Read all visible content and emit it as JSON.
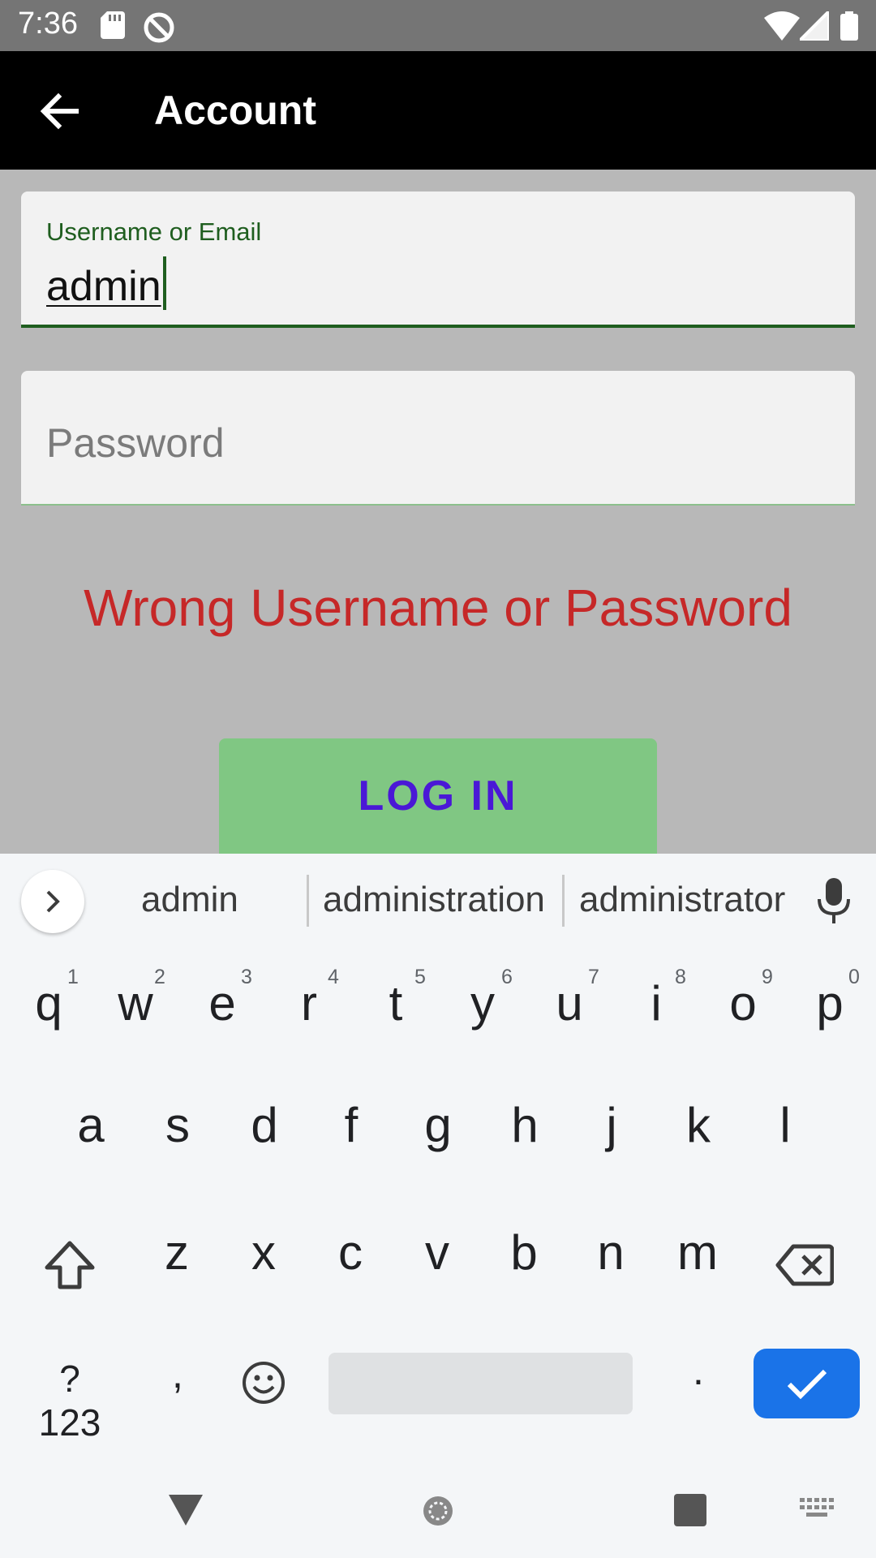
{
  "status_bar": {
    "time": "7:36"
  },
  "app_bar": {
    "title": "Account"
  },
  "form": {
    "username_label": "Username or Email",
    "username_value": "admin",
    "password_placeholder": "Password",
    "error_message": "Wrong Username or Password",
    "login_label": "LOG IN"
  },
  "keyboard": {
    "suggestions": [
      "admin",
      "administration",
      "administrator"
    ],
    "row1": [
      {
        "key": "q",
        "hint": "1"
      },
      {
        "key": "w",
        "hint": "2"
      },
      {
        "key": "e",
        "hint": "3"
      },
      {
        "key": "r",
        "hint": "4"
      },
      {
        "key": "t",
        "hint": "5"
      },
      {
        "key": "y",
        "hint": "6"
      },
      {
        "key": "u",
        "hint": "7"
      },
      {
        "key": "i",
        "hint": "8"
      },
      {
        "key": "o",
        "hint": "9"
      },
      {
        "key": "p",
        "hint": "0"
      }
    ],
    "row2": [
      "a",
      "s",
      "d",
      "f",
      "g",
      "h",
      "j",
      "k",
      "l"
    ],
    "row3": [
      "z",
      "x",
      "c",
      "v",
      "b",
      "n",
      "m"
    ],
    "symbols_label": "?123",
    "comma": ",",
    "period": "."
  },
  "colors": {
    "accent_green": "#1f5e1f",
    "error_red": "#c62828",
    "login_button": "#80c783",
    "enter_key": "#1a73e8"
  }
}
